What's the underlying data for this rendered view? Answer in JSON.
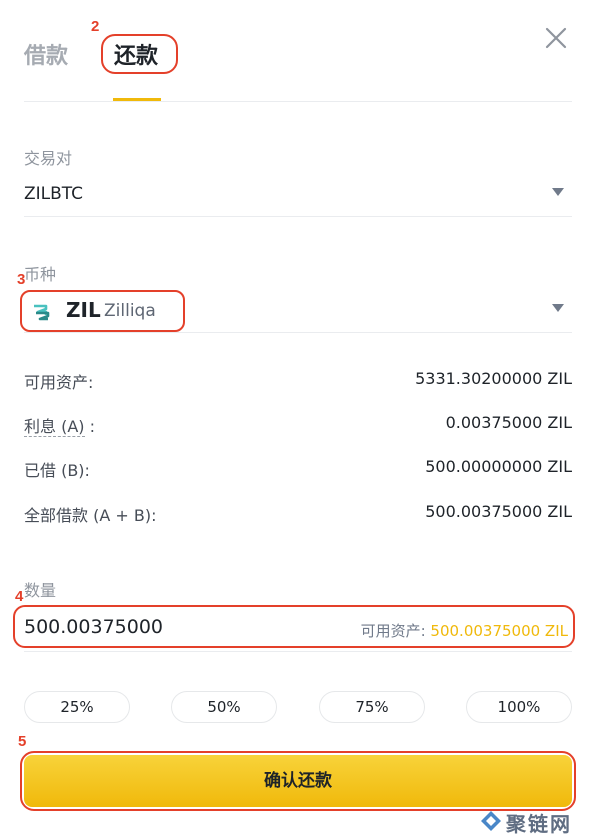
{
  "tabs": {
    "borrow_label": "借款",
    "repay_label": "还款"
  },
  "annotations": [
    "2",
    "3",
    "4",
    "5"
  ],
  "pair": {
    "label": "交易对",
    "value": "ZILBTC"
  },
  "coin": {
    "label": "币种",
    "symbol": "ZIL",
    "name": "Zilliqa",
    "logo_color": "#49c1bf"
  },
  "info": [
    {
      "label": "可用资产:",
      "value": "5331.30200000 ZIL"
    },
    {
      "label": "利息 (A)",
      "suffix": " :",
      "value": "0.00375000 ZIL"
    },
    {
      "label": "已借 (B):",
      "value": "500.00000000 ZIL"
    },
    {
      "label": "全部借款 (A + B):",
      "value": "500.00375000 ZIL"
    }
  ],
  "amount": {
    "label": "数量",
    "value": "500.00375000",
    "available_label": "可用资产: ",
    "available_value": "500.00375000 ZIL"
  },
  "percent_buttons": [
    "25%",
    "50%",
    "75%",
    "100%"
  ],
  "confirm_label": "确认还款",
  "watermark": {
    "text": "聚链网"
  },
  "colors": {
    "accent": "#f0b90b",
    "annotation": "#e4402a"
  },
  "icons": {
    "close": "close-icon",
    "caret": "caret-down-icon",
    "coin": "zil-logo-icon"
  }
}
